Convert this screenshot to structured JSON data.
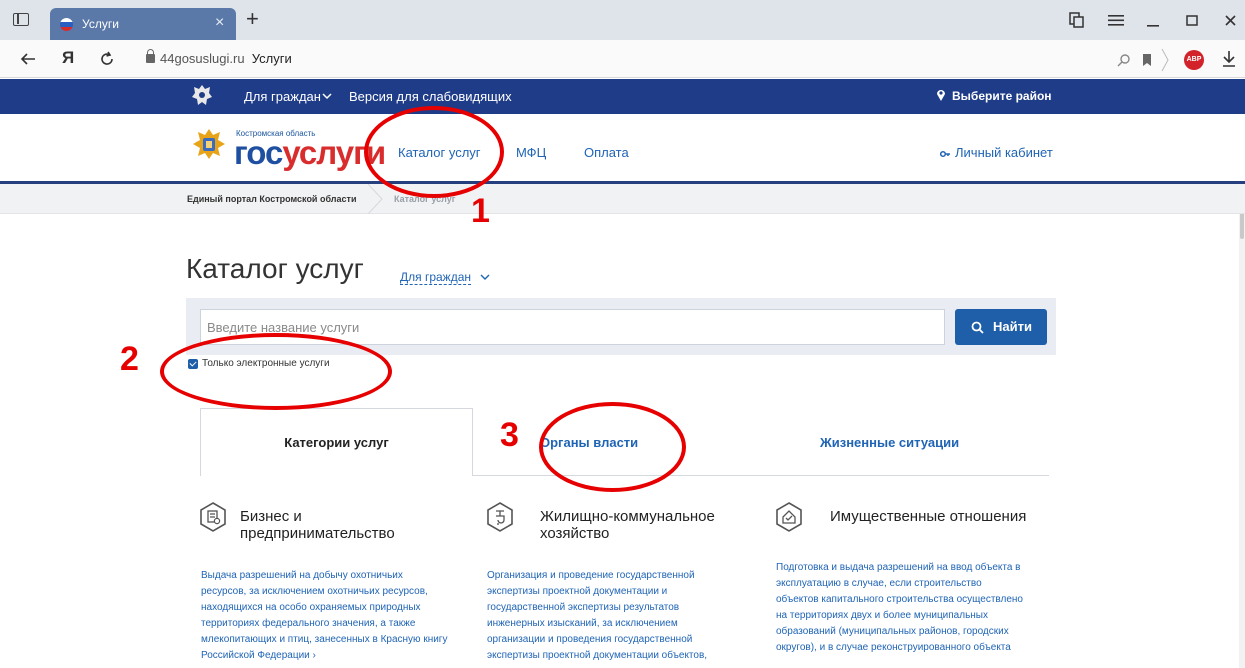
{
  "browser": {
    "tab_title": "Услуги",
    "tab_close": "×",
    "new_tab": "+",
    "address_domain": "44gosuslugi.ru",
    "address_title": "Услуги",
    "abp_label": "ABP"
  },
  "site": {
    "topnav": {
      "for_citizens": "Для граждан",
      "accessible_version": "Версия для слабовидящих",
      "choose_district": "Выберите район"
    },
    "logo": {
      "small": "Костромская область",
      "part1": "гос",
      "part2": "услуги"
    },
    "mainnav": {
      "catalog": "Каталог услуг",
      "mfc": "МФЦ",
      "payment": "Оплата",
      "cabinet": "Личный кабинет"
    },
    "breadcrumbs": {
      "home": "Единый портал Костромской области",
      "current": "Каталог услуг"
    }
  },
  "catalog": {
    "title": "Каталог услуг",
    "audience": "Для граждан",
    "search_placeholder": "Введите название услуги",
    "search_button": "Найти",
    "electronic_only": "Только электронные услуги",
    "electronic_only_checked": true
  },
  "tabs": {
    "categories": "Категории услуг",
    "authorities": "Органы власти",
    "life_situations": "Жизненные ситуации",
    "active": "categories"
  },
  "categories": [
    {
      "title_line1": "Бизнес и",
      "title_line2": "предпринимательство",
      "desc": [
        "Выдача разрешений на добычу охотничьих",
        "ресурсов, за исключением охотничьих ресурсов,",
        "находящихся на особо охраняемых природных",
        "территориях федерального значения, а также",
        "млекопитающих и птиц, занесенных в Красную книгу",
        "Российской Федерации ›"
      ]
    },
    {
      "title_line1": "Жилищно-коммунальное",
      "title_line2": "хозяйство",
      "desc": [
        "Организация и проведение государственной",
        "экспертизы проектной документации и",
        "государственной экспертизы результатов",
        "инженерных изысканий, за исключением",
        "организации и проведения государственной",
        "экспертизы проектной документации объектов,"
      ]
    },
    {
      "title_line1": "Имущественные отношения",
      "title_line2": "",
      "desc": [
        "Подготовка и выдача разрешений на ввод объекта в",
        "эксплуатацию в случае, если строительство",
        "объектов капитального строительства осуществлено",
        "на территориях двух и более муниципальных",
        "образований (муниципальных районов, городских",
        "округов), и в случае реконструированного объекта"
      ]
    }
  ],
  "annotations": {
    "n1": "1",
    "n2": "2",
    "n3": "3",
    "color": "#e60000"
  }
}
